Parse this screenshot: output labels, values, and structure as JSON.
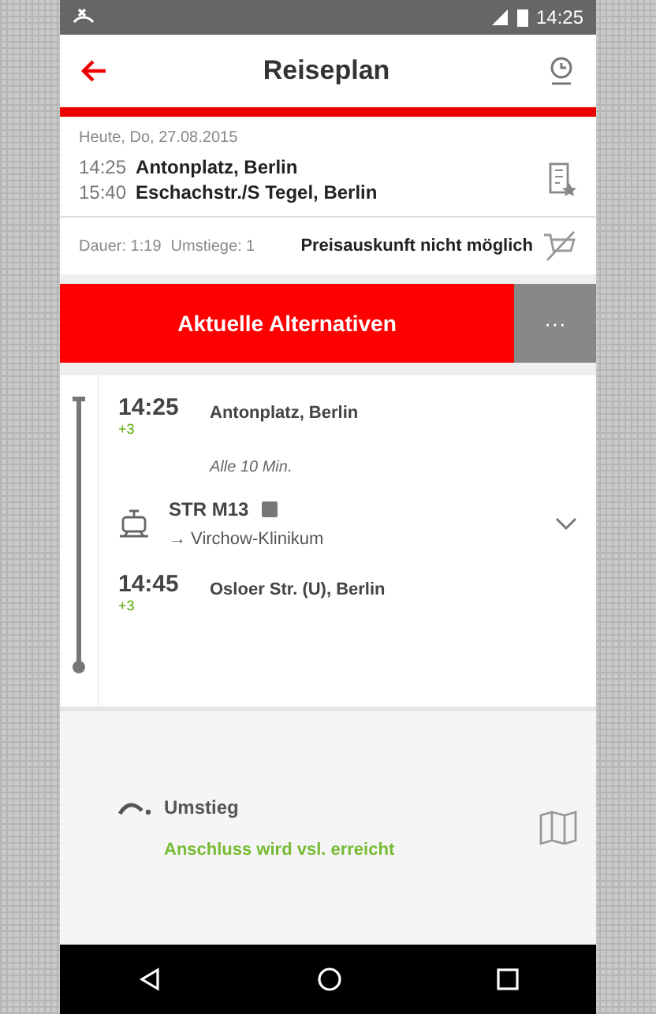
{
  "status_bar": {
    "time": "14:25"
  },
  "header": {
    "title": "Reiseplan"
  },
  "summary": {
    "date": "Heute, Do, 27.08.2015",
    "stops": [
      {
        "time": "14:25",
        "place": "Antonplatz, Berlin"
      },
      {
        "time": "15:40",
        "place": "Eschachstr./S Tegel, Berlin"
      }
    ],
    "duration": "Dauer: 1:19",
    "changes": "Umstiege: 1",
    "price": "Preisauskunft nicht möglich"
  },
  "actions": {
    "primary": "Aktuelle Alternativen",
    "more": "···"
  },
  "leg": {
    "departure": {
      "time": "14:25",
      "delay": "+3",
      "place": "Antonplatz, Berlin"
    },
    "frequency": "Alle 10 Min.",
    "line": "STR M13",
    "direction": "→ Virchow-Klinikum",
    "expanded": false,
    "arrival": {
      "time": "14:45",
      "delay": "+3",
      "place": "Osloer Str. (U), Berlin"
    }
  },
  "transfer": {
    "label": "Umstieg",
    "status": "Anschluss wird vsl. erreicht"
  }
}
